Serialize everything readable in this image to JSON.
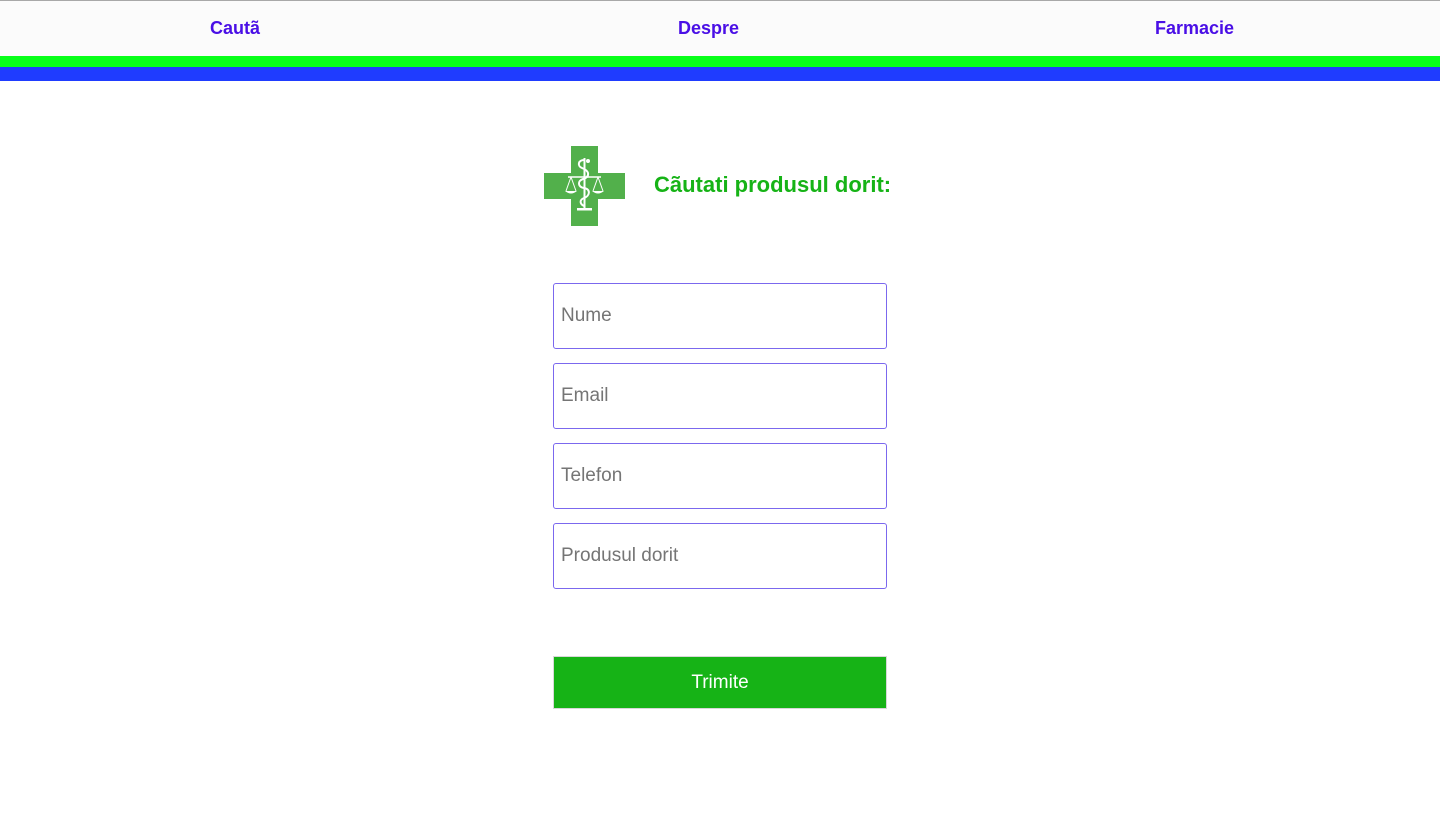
{
  "nav": {
    "items": [
      {
        "label": "Cautã"
      },
      {
        "label": "Despre"
      },
      {
        "label": "Farmacie"
      }
    ]
  },
  "colors": {
    "nav_link": "#4a0fe6",
    "stripe_green": "#08ff1a",
    "stripe_blue": "#1f3cff",
    "accent_green": "#16b316",
    "logo_green": "#52b04b",
    "field_border": "#7b68ee"
  },
  "logo": {
    "icon": "pharmacy-cross-caduceus-scales-icon"
  },
  "main": {
    "heading": "Cãutati produsul dorit:"
  },
  "form": {
    "fields": [
      {
        "placeholder": "Nume",
        "value": ""
      },
      {
        "placeholder": "Email",
        "value": ""
      },
      {
        "placeholder": "Telefon",
        "value": ""
      },
      {
        "placeholder": "Produsul dorit",
        "value": ""
      }
    ],
    "submit_label": "Trimite"
  }
}
